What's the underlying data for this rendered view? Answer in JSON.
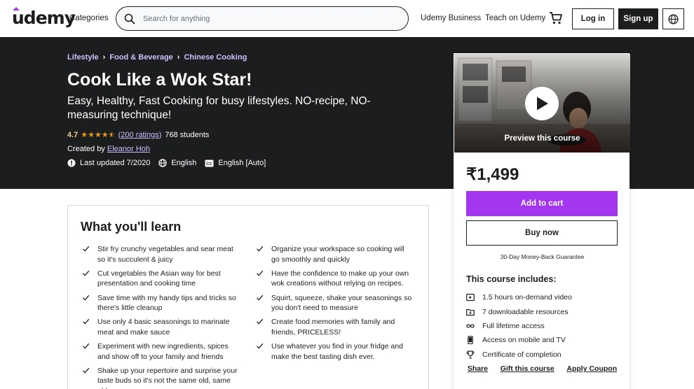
{
  "header": {
    "logo": "udemy",
    "categories": "Categories",
    "search_placeholder": "Search for anything",
    "business": "Udemy Business",
    "teach": "Teach on Udemy",
    "login": "Log in",
    "signup": "Sign up"
  },
  "hero": {
    "breadcrumbs": [
      "Lifestyle",
      "Food & Beverage",
      "Chinese Cooking"
    ],
    "title": "Cook Like a Wok Star!",
    "subtitle": "Easy, Healthy, Fast Cooking for busy lifestyles. NO-recipe, NO-measuring technique!",
    "rating": "4.7",
    "stars": 4.7,
    "ratings_count": "(200 ratings)",
    "students": "768 students",
    "created_by_label": "Created by",
    "instructor": "Eleanor Hoh",
    "last_updated": "Last updated 7/2020",
    "language": "English",
    "captions": "English [Auto]"
  },
  "card": {
    "preview_label": "Preview this course",
    "price": "₹1,499",
    "add_to_cart": "Add to cart",
    "buy_now": "Buy now",
    "guarantee": "30-Day Money-Back Guarantee",
    "includes_title": "This course includes:",
    "includes": [
      {
        "icon": "video-icon",
        "text": "1.5 hours on-demand video"
      },
      {
        "icon": "folder-icon",
        "text": "7 downloadable resources"
      },
      {
        "icon": "infinity-icon",
        "text": "Full lifetime access"
      },
      {
        "icon": "mobile-icon",
        "text": "Access on mobile and TV"
      },
      {
        "icon": "trophy-icon",
        "text": "Certificate of completion"
      }
    ],
    "share": "Share",
    "gift": "Gift this course",
    "coupon": "Apply Coupon",
    "accent": "#a435f0"
  },
  "learn": {
    "title": "What you'll learn",
    "left": [
      "Stir fry crunchy vegetables and sear meat so it's succulent & juicy",
      "Cut vegetables the Asian way for best presentation and cooking time",
      "Save time with my handy tips and tricks so there's little cleanup",
      "Use only 4 basic seasonings to marinate meat and make sauce",
      "Experiment with new ingredients, spices and show off to your family and friends",
      "Shake up your repertoire and surprise your taste buds so it's not the same old, same old."
    ],
    "right": [
      "Organize your workspace so cooking will go smoothly and quickly",
      "Have the confidence to make up your own wok creations without relying on recipes.",
      "Squirt, squeeze, shake your seasonings so you don't need to measure",
      "Create food memories with family and friends, PRICELESS!",
      "Use whatever you find in your fridge and make the best tasting dish ever."
    ]
  }
}
